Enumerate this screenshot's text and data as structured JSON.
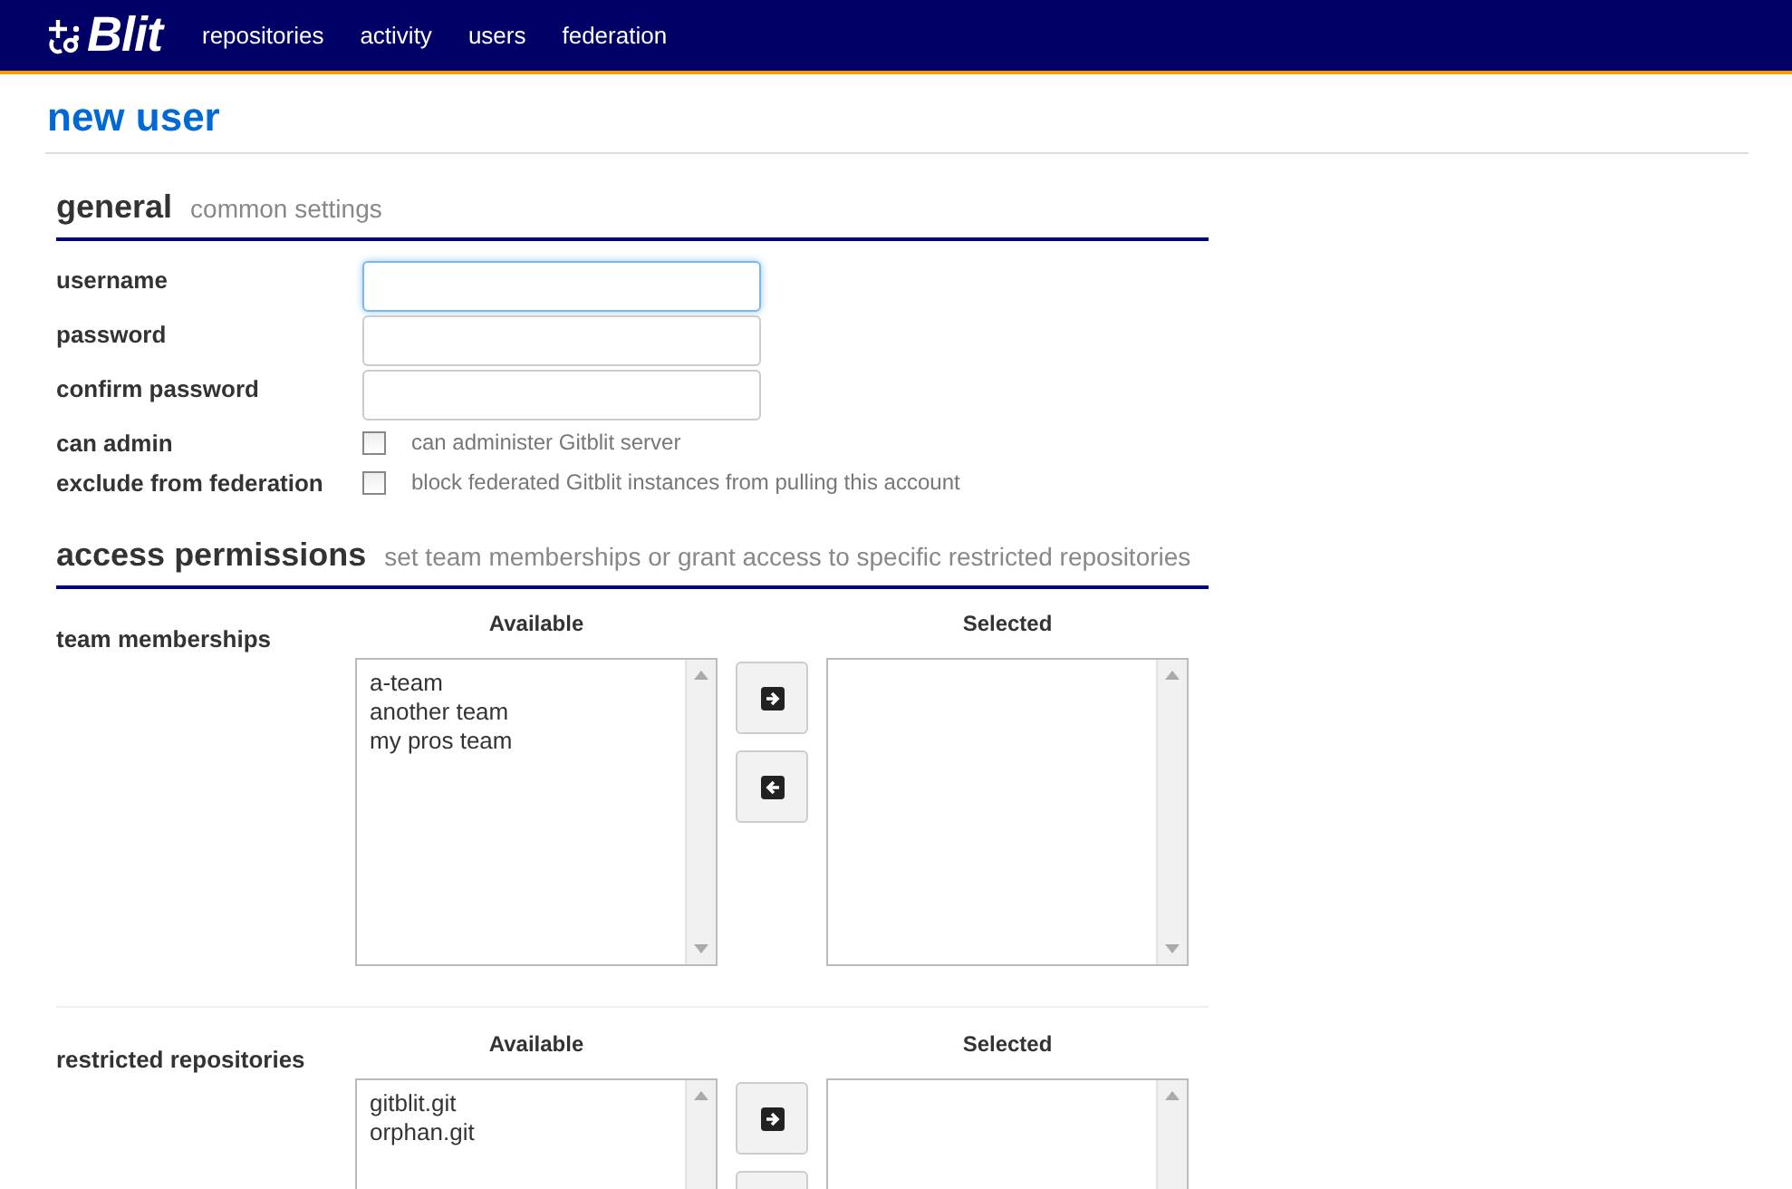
{
  "header": {
    "logo": "Blit",
    "nav": [
      {
        "label": "repositories"
      },
      {
        "label": "activity"
      },
      {
        "label": "users"
      },
      {
        "label": "federation"
      }
    ]
  },
  "page_title": "new user",
  "sections": [
    {
      "title": "general",
      "subtitle": "common settings",
      "rows": [
        {
          "kind": "text",
          "label": "username",
          "focused": true
        },
        {
          "kind": "password",
          "label": "password",
          "focused": false
        },
        {
          "kind": "password",
          "label": "confirm password",
          "focused": false
        },
        {
          "kind": "checkbox",
          "label": "can admin",
          "checked": false,
          "hint": "can administer Gitblit server"
        },
        {
          "kind": "checkbox",
          "label": "exclude from federation",
          "checked": false,
          "hint": "block federated Gitblit instances from pulling this account"
        }
      ]
    },
    {
      "title": "access permissions",
      "subtitle": "set team memberships or grant access to specific restricted repositories",
      "pickers": [
        {
          "label": "team memberships",
          "available_title": "Available",
          "selected_title": "Selected",
          "available": [
            "a-team",
            "another team",
            "my pros team"
          ]
        },
        {
          "label": "restricted repositories",
          "available_title": "Available",
          "selected_title": "Selected",
          "available": [
            "gitblit.git",
            "orphan.git"
          ]
        }
      ]
    }
  ]
}
